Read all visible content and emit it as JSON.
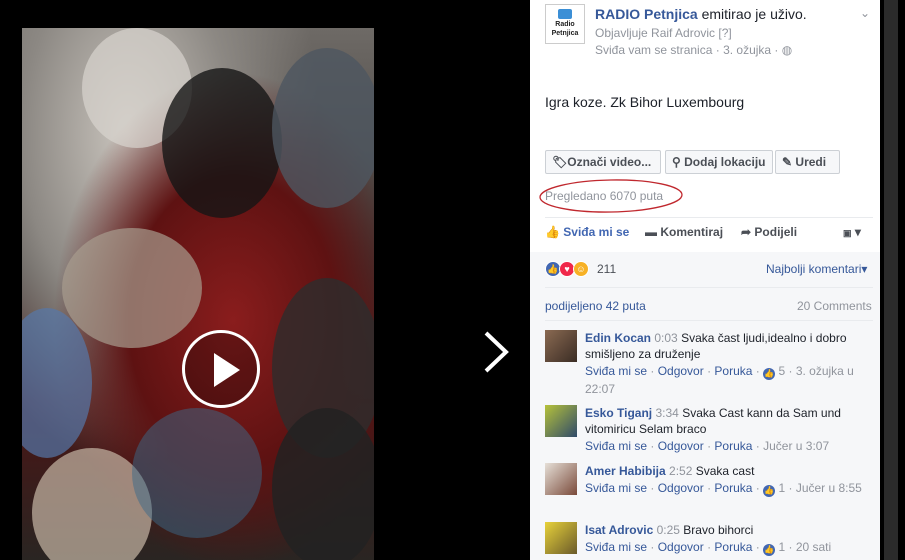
{
  "video": {
    "play_label": "Play"
  },
  "post": {
    "page_name": "RADIO Petnjica",
    "page_avatar_text": "Radio Petnjica",
    "header_suffix": "emitirao je uživo.",
    "published_by": "Objavljuje Raif Adrovic",
    "published_by_mark": "[?]",
    "likes_page": "Sviđa vam se stranica",
    "date": "3. ožujka",
    "text": "Igra koze. Zk Bihor Luxembourg",
    "buttons": [
      "Označi video...",
      "Dodaj lokaciju",
      "Uredi"
    ],
    "views": "Pregledano 6070 puta",
    "actions": {
      "like": "Sviđa mi se",
      "comment": "Komentiraj",
      "share": "Podijeli"
    },
    "reaction_count": "211",
    "sort_label": "Najbolji komentari",
    "shares": "podijeljeno 42 puta",
    "comments_count": "20 Comments"
  },
  "comment_actions": {
    "like": "Sviđa mi se",
    "reply": "Odgovor",
    "message": "Poruka"
  },
  "comments": [
    {
      "name": "Edin Kocan",
      "time": "0:03",
      "text": "Svaka čast ljudi,idealno i dobro smišljeno za druženje",
      "likes": "5",
      "date": "3. ožujka u 22:07"
    },
    {
      "name": "Esko Tiganj",
      "time": "3:34",
      "text": "Svaka Cast kann da Sam und vitomiricu Selam braco",
      "likes": "",
      "date": "Jučer u 3:07"
    },
    {
      "name": "Amer Habibija",
      "time": "2:52",
      "text": "Svaka cast",
      "likes": "1",
      "date": "Jučer u 8:55"
    },
    {
      "name": "Isat Adrovic",
      "time": "0:25",
      "text": "Bravo bihorci",
      "likes": "1",
      "date": "20 sati"
    }
  ],
  "colors": {
    "link": "#365899",
    "muted": "#90949c",
    "annotation": "#c0282e"
  }
}
